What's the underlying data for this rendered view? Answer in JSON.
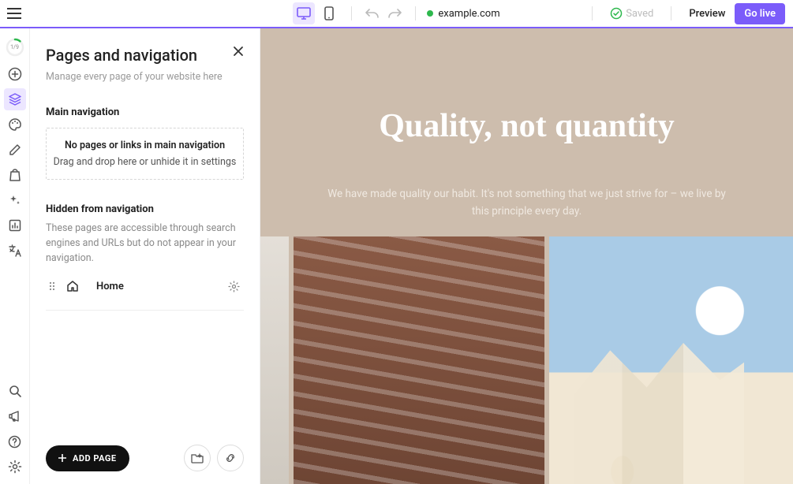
{
  "topbar": {
    "domain": "example.com",
    "saved_label": "Saved",
    "preview_label": "Preview",
    "golive_label": "Go live"
  },
  "rail": {
    "progress": "1/9"
  },
  "panel": {
    "title": "Pages and navigation",
    "subtitle": "Manage every page of your website here",
    "main_nav_title": "Main navigation",
    "dropzone_main": "No pages or links in main navigation",
    "dropzone_sub": "Drag and drop here or unhide it in settings",
    "hidden_title": "Hidden from navigation",
    "hidden_desc": "These pages are accessible through search engines and URLs but do not appear in your navigation.",
    "home_label": "Home",
    "add_page_label": "ADD PAGE"
  },
  "hero": {
    "title": "Quality, not quantity",
    "line1": "We have made quality our habit. It's not something that we just strive for  – we live by",
    "line2": "this principle every day."
  }
}
